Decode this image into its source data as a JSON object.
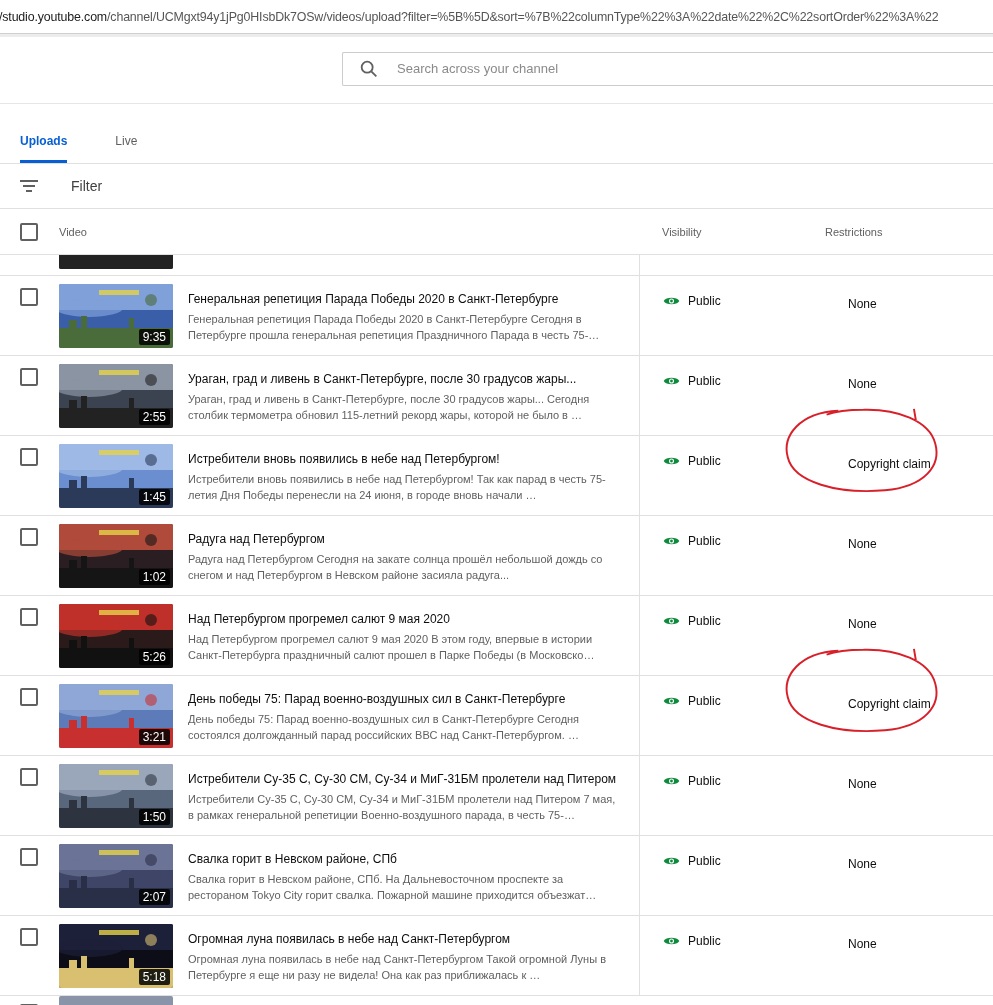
{
  "address_bar": {
    "host": "/studio.youtube.com",
    "path": "/channel/UCMgxt94y1jPg0HIsbDk7OSw/videos/upload?filter=%5B%5D&sort=%7B%22columnType%22%3A%22date%22%2C%22sortOrder%22%3A%22"
  },
  "search": {
    "placeholder": "Search across your channel"
  },
  "tabs": [
    {
      "label": "Uploads",
      "selected": true
    },
    {
      "label": "Live",
      "selected": false
    }
  ],
  "filter": {
    "label": "Filter"
  },
  "table": {
    "select_all": {
      "checked": false
    },
    "columns": [
      "Video",
      "Visibility",
      "Restrictions"
    ],
    "rows": [
      {
        "checked": false,
        "duration": "9:35",
        "title": "Генеральная репетиция Парада Победы 2020 в Санкт-Петербурге",
        "description": "Генеральная репетиция Парада Победы 2020 в Санкт-Петербурге Сегодня в Петербурге прошла генеральная репетиция Праздничного Парада в честь 75-…",
        "visibility": "Public",
        "restrictions": "None",
        "annotated": false
      },
      {
        "checked": false,
        "duration": "2:55",
        "title": "Ураган, град и ливень в Санкт-Петербурге, после 30 градусов жары...",
        "description": "Ураган, град и ливень в Санкт-Петербурге, после 30 градусов жары... Сегодня столбик термометра обновил 115-летний рекорд жары, которой не было в …",
        "visibility": "Public",
        "restrictions": "None",
        "annotated": false
      },
      {
        "checked": false,
        "duration": "1:45",
        "title": "Истребители вновь появились в небе над Петербургом!",
        "description": "Истребители вновь появились в небе над Петербургом! Так как парад в честь 75-летия Дня Победы перенесли на 24 июня, в городе вновь начали …",
        "visibility": "Public",
        "restrictions": "Copyright claim",
        "annotated": true
      },
      {
        "checked": false,
        "duration": "1:02",
        "title": "Радуга над Петербургом",
        "description": "Радуга над Петербургом Сегодня на закате солнца прошёл небольшой дождь со снегом и над Петербургом в Невском районе засияла радуга...",
        "visibility": "Public",
        "restrictions": "None",
        "annotated": false
      },
      {
        "checked": false,
        "duration": "5:26",
        "title": "Над Петербургом прогремел салют 9 мая 2020",
        "description": "Над Петербургом прогремел салют 9 мая 2020 В этом году, впервые в истории Санкт-Петербурга праздничный салют прошел в Парке Победы (в Московско…",
        "visibility": "Public",
        "restrictions": "None",
        "annotated": false
      },
      {
        "checked": false,
        "duration": "3:21",
        "title": "День победы 75: Парад военно-воздушных сил в Санкт-Петербурге",
        "description": "День победы 75: Парад военно-воздушных сил в Санкт-Петербурге Сегодня состоялся долгожданный парад российских ВВС над Санкт-Петербургом. …",
        "visibility": "Public",
        "restrictions": "Copyright claim",
        "annotated": true
      },
      {
        "checked": false,
        "duration": "1:50",
        "title": "Истребители Су-35 С, Су-30 СМ, Су-34 и МиГ-31БМ пролетели над Питером",
        "description": "Истребители Су-35 С, Су-30 СМ, Су-34 и МиГ-31БМ пролетели над Питером 7 мая, в рамках генеральной репетиции Военно-воздушного парада, в честь 75-…",
        "visibility": "Public",
        "restrictions": "None",
        "annotated": false
      },
      {
        "checked": false,
        "duration": "2:07",
        "title": "Свалка горит в Невском районе, СПб",
        "description": "Свалка горит в Невском районе, СПб. На Дальневосточном проспекте за рестораном Tokyo City горит свалка. Пожарной машине приходится объезжат…",
        "visibility": "Public",
        "restrictions": "None",
        "annotated": false
      },
      {
        "checked": false,
        "duration": "5:18",
        "title": "Огромная луна появилась в небе над Санкт-Петербургом",
        "description": "Огромная луна появилась в небе над Санкт-Петербургом Такой огромной Луны в Петербурге я еще ни разу не видела! Она как раз приближалась к …",
        "visibility": "Public",
        "restrictions": "None",
        "annotated": false
      }
    ],
    "partial_row_bottom": {
      "checked": false
    }
  }
}
